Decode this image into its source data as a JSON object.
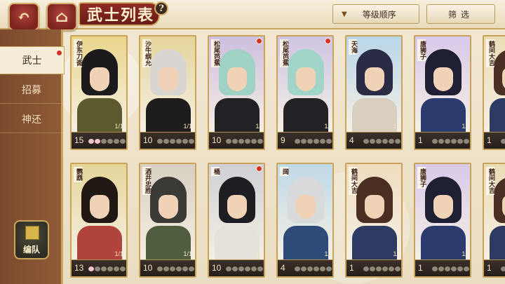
{
  "header": {
    "title": "武士列表",
    "help": "?",
    "sort_label": "等级顺序",
    "filter_label": "筛选"
  },
  "sidebar": {
    "tabs": [
      "武士",
      "招募",
      "神还"
    ],
    "formation_label": "编队"
  },
  "colors": {
    "accent_red": "#8e2b24",
    "gold_border": "#caa35b",
    "sidebar_brown": "#7b4a2d"
  },
  "cards": [
    {
      "name": "伊东刀斋",
      "level": "15",
      "count": "1/1",
      "bg": "#e9d68c",
      "hair": "#1c1a1a",
      "cloth": "#5b5a2f",
      "pips": 2,
      "dot": false
    },
    {
      "name": "沙牛纲允",
      "level": "10",
      "count": "1/1",
      "bg": "#e6d49a",
      "hair": "#d9d6d2",
      "cloth": "#1e1c1c",
      "pips": 0,
      "dot": false
    },
    {
      "name": "松尾芭蕉",
      "level": "10",
      "count": "1/",
      "bg": "#cdbfe0",
      "hair": "#9fd1c5",
      "cloth": "#222226",
      "pips": 0,
      "dot": true
    },
    {
      "name": "松尾芭蕉",
      "level": "9",
      "count": "1/",
      "bg": "#cfc4e3",
      "hair": "#a2d5c9",
      "cloth": "#222226",
      "pips": 0,
      "dot": true
    },
    {
      "name": "天海",
      "level": "4",
      "count": "1/",
      "bg": "#b9d6ea",
      "hair": "#2a2b45",
      "cloth": "#d8cfc0",
      "pips": 0,
      "dot": false
    },
    {
      "name": "唐狮子",
      "level": "1",
      "count": "1/",
      "bg": "#d8c9ea",
      "hair": "#1e1f33",
      "cloth": "#2b3b6e",
      "pips": 0,
      "dot": false
    },
    {
      "name": "鹤间大吉",
      "level": "1",
      "count": "",
      "bg": "#eadcb5",
      "hair": "#4a3024",
      "cloth": "#2d3a62",
      "pips": 0,
      "dot": false
    },
    {
      "name": "鹦鹉",
      "level": "13",
      "count": "1/1",
      "bg": "#e6d59a",
      "hair": "#201812",
      "cloth": "#b0443c",
      "pips": 1,
      "dot": false
    },
    {
      "name": "酒井忠胜",
      "level": "10",
      "count": "1/1",
      "bg": "#d6cfc2",
      "hair": "#3c3a36",
      "cloth": "#4f5e3e",
      "pips": 0,
      "dot": false
    },
    {
      "name": "桶",
      "level": "10",
      "count": "1/",
      "bg": "#cfd0d6",
      "hair": "#1e1e22",
      "cloth": "#e6e2da",
      "pips": 0,
      "dot": true
    },
    {
      "name": "阔",
      "level": "4",
      "count": "1/",
      "bg": "#bfd9e6",
      "hair": "#d8dadb",
      "cloth": "#2d4a78",
      "pips": 0,
      "dot": false
    },
    {
      "name": "鹤间大吉",
      "level": "1",
      "count": "1/",
      "bg": "#efdcbf",
      "hair": "#4a2e22",
      "cloth": "#2d3a62",
      "pips": 0,
      "dot": false
    },
    {
      "name": "唐狮子",
      "level": "1",
      "count": "1/",
      "bg": "#d8c9ea",
      "hair": "#1e1f33",
      "cloth": "#2b3b6e",
      "pips": 0,
      "dot": false
    },
    {
      "name": "鹤间大吉",
      "level": "1",
      "count": "",
      "bg": "#eadcb5",
      "hair": "#4a3024",
      "cloth": "#2d3a62",
      "pips": 0,
      "dot": false
    }
  ]
}
